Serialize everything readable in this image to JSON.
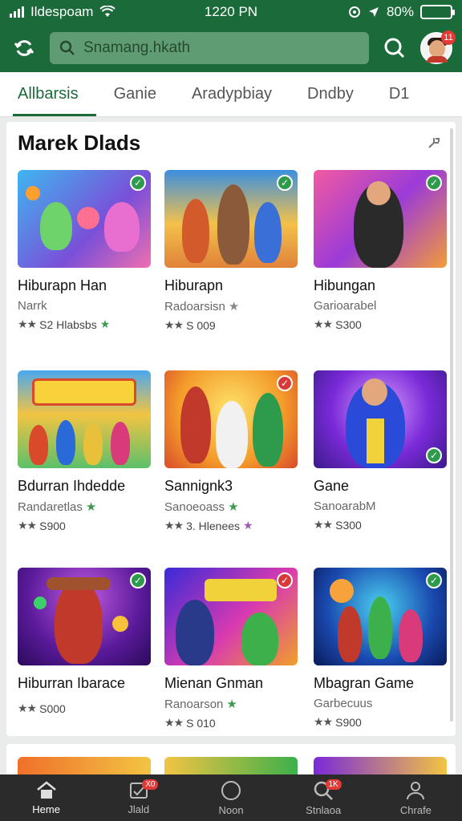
{
  "status_bar": {
    "carrier": "Ildespoam",
    "time": "1220 PN",
    "battery": "80%",
    "battery_level": 0.8
  },
  "app_bar": {
    "search_placeholder": "Snamang.hkath",
    "avatar_badge": "11"
  },
  "tabs": [
    {
      "label": "Allbarsis",
      "active": true
    },
    {
      "label": "Ganie",
      "active": false
    },
    {
      "label": "Aradypbiay",
      "active": false
    },
    {
      "label": "Dndby",
      "active": false
    },
    {
      "label": "D1",
      "active": false
    }
  ],
  "section": {
    "title": "Marek Dlads"
  },
  "cards": [
    {
      "title": "Hiburapn Han",
      "subtitle": "Narrk",
      "rating": "S2 Hlabsbs",
      "star_color": "green",
      "check": "green"
    },
    {
      "title": "Hiburapn",
      "subtitle": "Radoarsisn",
      "rating": "S 009",
      "star_color": "gray",
      "check": "green"
    },
    {
      "title": "Hibungan",
      "subtitle": "Garioarabel",
      "rating": "S300",
      "star_color": "none",
      "check": "green"
    },
    {
      "title": "Bdurran Ihdedde",
      "subtitle": "Randaretlas",
      "rating": "S900",
      "star_color": "none",
      "check": "none"
    },
    {
      "title": "Sannignk3",
      "subtitle": "Sanoeoass",
      "rating": "3. Hlenees",
      "star_color": "purple",
      "check": "red"
    },
    {
      "title": "Gane",
      "subtitle": "SanoarabM",
      "rating": "S300",
      "star_color": "none",
      "check": "green"
    },
    {
      "title": "Hiburran Ibarace",
      "subtitle": "",
      "rating": "S000",
      "star_color": "none",
      "check": "green"
    },
    {
      "title": "Mienan Gnman",
      "subtitle": "Ranoarson",
      "rating": "S 010",
      "star_color": "none",
      "check": "red"
    },
    {
      "title": "Mbagran Game",
      "subtitle": "Garbecuus",
      "rating": "S900",
      "star_color": "none",
      "check": "green"
    }
  ],
  "bottom_nav": [
    {
      "label": "Heme",
      "icon": "home-icon",
      "active": true
    },
    {
      "label": "Jlald",
      "icon": "library-icon",
      "active": false,
      "badge": "X0"
    },
    {
      "label": "Noon",
      "icon": "circle-icon",
      "active": false
    },
    {
      "label": "Stnlaoa",
      "icon": "search-icon",
      "active": false,
      "badge": "1K"
    },
    {
      "label": "Chrafe",
      "icon": "profile-icon",
      "active": false
    }
  ],
  "colors": {
    "brand": "#1b6a3a",
    "search_field": "#5f9c74",
    "tab_indicator": "#1b6a3a",
    "nav_bg": "#2b2b2b",
    "badge": "#e53935"
  }
}
